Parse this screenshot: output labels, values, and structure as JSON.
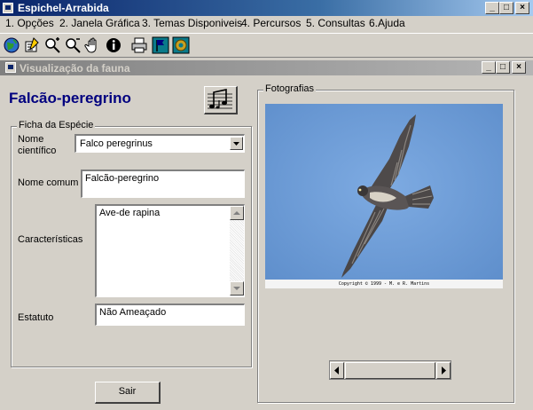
{
  "app": {
    "title": "Espichel-Arrabida"
  },
  "menu": [
    "1. Opções",
    "2. Janela Gráfica",
    "3. Temas Disponiveis",
    "4. Percursos",
    "5. Consultas",
    "6.Ajuda"
  ],
  "toolbar": {
    "icons": [
      "globe-icon",
      "edit-layer-icon",
      "zoom-in-icon",
      "zoom-out-icon",
      "pan-hand-icon",
      "info-icon",
      "print-icon",
      "flag-icon",
      "map-icon"
    ]
  },
  "child_window": {
    "title": "Visualização da fauna"
  },
  "species": {
    "heading": "Falcão-peregrino",
    "group_label": "Ficha da Espécie",
    "scientific_label": "Nome científico",
    "scientific_value": "Falco peregrinus",
    "common_label": "Nome comum",
    "common_value": "Falcão-peregrino",
    "characteristics_label": "Características",
    "characteristics_value": "Ave-de rapina",
    "status_label": "Estatuto",
    "status_value": "Não Ameaçado"
  },
  "photos": {
    "group_label": "Fotografias",
    "caption": "Copyright © 1999 - M. e R. Martins"
  },
  "buttons": {
    "exit": "Sair"
  },
  "colors": {
    "title_active": "#0a246a",
    "title_inactive": "#808080",
    "species_heading": "#00007f",
    "photo_sky": "#6f9fd8"
  }
}
